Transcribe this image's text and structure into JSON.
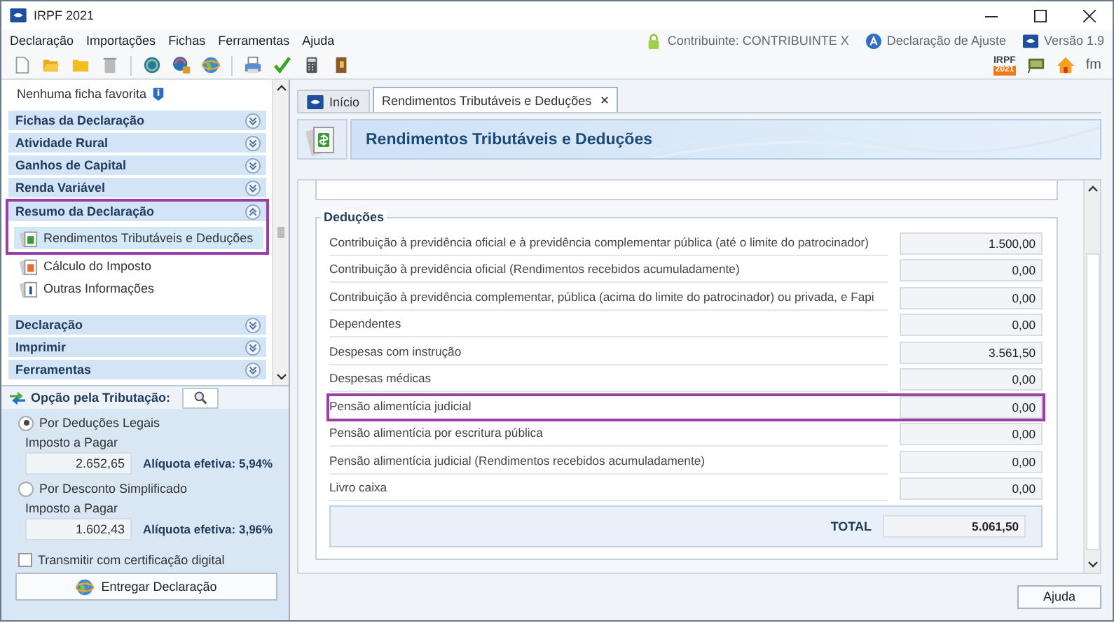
{
  "window": {
    "title": "IRPF 2021"
  },
  "menu": [
    "Declaração",
    "Importações",
    "Fichas",
    "Ferramentas",
    "Ajuda"
  ],
  "status": {
    "contributor": "Contribuinte: CONTRIBUINTE X",
    "declaration": "Declaração de Ajuste",
    "version": "Versão 1.9"
  },
  "toolbar": [
    {
      "kind": "new"
    },
    {
      "kind": "open"
    },
    {
      "kind": "folder"
    },
    {
      "kind": "trash"
    },
    {
      "kind": "separator"
    },
    {
      "kind": "sync"
    },
    {
      "kind": "sync-lock"
    },
    {
      "kind": "globe"
    },
    {
      "kind": "separator"
    },
    {
      "kind": "printer"
    },
    {
      "kind": "check"
    },
    {
      "kind": "calculator"
    },
    {
      "kind": "book"
    }
  ],
  "toolbar_right": [
    {
      "kind": "irpf",
      "text": "IRPF",
      "year": "2021"
    },
    {
      "kind": "monitor"
    },
    {
      "kind": "home"
    },
    {
      "kind": "fm",
      "text": "fm"
    }
  ],
  "sidebar": {
    "favorites": "Nenhuma ficha favorita",
    "sections": [
      {
        "title": "Fichas da Declaração",
        "expanded": false,
        "highlighted": false
      },
      {
        "title": "Atividade Rural",
        "expanded": false,
        "highlighted": false
      },
      {
        "title": "Ganhos de Capital",
        "expanded": false,
        "highlighted": false
      },
      {
        "title": "Renda Variável",
        "expanded": false,
        "highlighted": false
      },
      {
        "title": "Resumo da Declaração",
        "expanded": true,
        "highlighted": true,
        "items": [
          {
            "label": "Rendimentos Tributáveis e Deduções",
            "kind": "money",
            "selected": true,
            "highlighted": true
          },
          {
            "label": "Cálculo do Imposto",
            "kind": "percent",
            "selected": false,
            "highlighted": false
          },
          {
            "label": "Outras Informações",
            "kind": "info",
            "selected": false,
            "highlighted": false
          }
        ]
      },
      {
        "title": "Declaração",
        "expanded": false,
        "highlighted": false
      },
      {
        "title": "Imprimir",
        "expanded": false,
        "highlighted": false
      },
      {
        "title": "Ferramentas",
        "expanded": false,
        "highlighted": false
      }
    ]
  },
  "tax_option": {
    "title": "Opção pela Tributação:",
    "options": [
      {
        "label": "Por Deduções Legais",
        "selected": true,
        "field_label": "Imposto a Pagar",
        "value": "2.652,65",
        "rate": "Alíquota efetiva: 5,94%"
      },
      {
        "label": "Por Desconto Simplificado",
        "selected": false,
        "field_label": "Imposto a Pagar",
        "value": "1.602,43",
        "rate": "Alíquota efetiva: 3,96%"
      }
    ],
    "certificate": {
      "label": "Transmitir com certificação digital",
      "checked": false
    },
    "submit": "Entregar Declaração"
  },
  "tabs": [
    {
      "label": "Início",
      "selected": false,
      "closable": false
    },
    {
      "label": "Rendimentos Tributáveis e Deduções",
      "selected": true,
      "closable": true
    }
  ],
  "page": {
    "title": "Rendimentos Tributáveis e Deduções",
    "section": "Deduções",
    "rows": [
      {
        "label": "Contribuição à previdência oficial e à previdência complementar pública (até o limite do patrocinador)",
        "value": "1.500,00",
        "highlighted": false
      },
      {
        "label": "Contribuição à previdência oficial (Rendimentos recebidos acumuladamente)",
        "value": "0,00",
        "highlighted": false
      },
      {
        "label": "Contribuição à previdência complementar, pública (acima do limite do patrocinador) ou privada, e Fapi",
        "value": "0,00",
        "highlighted": false
      },
      {
        "label": "Dependentes",
        "value": "0,00",
        "highlighted": false
      },
      {
        "label": "Despesas com instrução",
        "value": "3.561,50",
        "highlighted": false
      },
      {
        "label": "Despesas médicas",
        "value": "0,00",
        "highlighted": false
      },
      {
        "label": "Pensão alimentícia judicial",
        "value": "0,00",
        "highlighted": true
      },
      {
        "label": "Pensão alimentícia por escritura pública",
        "value": "0,00",
        "highlighted": false
      },
      {
        "label": "Pensão alimentícia judicial (Rendimentos recebidos acumuladamente)",
        "value": "0,00",
        "highlighted": false
      },
      {
        "label": "Livro caixa",
        "value": "0,00",
        "highlighted": false
      }
    ],
    "total": {
      "label": "TOTAL",
      "value": "5.061,50"
    }
  },
  "help_button": "Ajuda"
}
